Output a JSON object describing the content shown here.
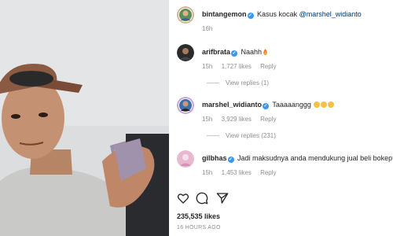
{
  "post": {
    "author": "bintangemon",
    "caption": "Kasus kocak",
    "mention": "@marshel_widianto",
    "time": "16h"
  },
  "comments": [
    {
      "username": "arifbrata",
      "text": "Naahh",
      "emoji": "fire",
      "time": "15h",
      "likes": "1,727 likes",
      "reply": "Reply",
      "view_replies": "View replies (1)"
    },
    {
      "username": "marshel_widianto",
      "text": "Taaaaanggg",
      "emoji": "laughing x3",
      "time": "15h",
      "likes": "3,929 likes",
      "reply": "Reply",
      "view_replies": "View replies (231)"
    },
    {
      "username": "gilbhas",
      "text": "Jadi maksudnya anda mendukung jual beli bokep?",
      "time": "15h",
      "likes": "1,453 likes",
      "reply": "Reply"
    }
  ],
  "actions": {
    "like_icon": "heart-icon",
    "comment_icon": "comment-icon",
    "share_icon": "share-icon"
  },
  "likes_total": "235,535 likes",
  "posted_ago": "16 HOURS AGO",
  "colors": {
    "verified": "#3897f0",
    "meta_text": "#8e8e8e",
    "mention": "#00376b"
  }
}
